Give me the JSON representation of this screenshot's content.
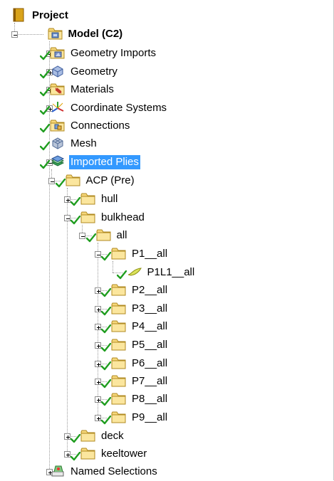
{
  "tree": {
    "nodes": [
      {
        "label": "Project",
        "icon": "project-book-icon",
        "bold": true,
        "checked": false,
        "toggle": "none"
      },
      {
        "label": "Model (C2)",
        "icon": "model-icon",
        "bold": true,
        "checked": false,
        "toggle": "expanded"
      },
      {
        "label": "Geometry Imports",
        "icon": "geometry-imports-folder-icon",
        "bold": false,
        "checked": true,
        "toggle": "collapsed"
      },
      {
        "label": "Geometry",
        "icon": "geometry-cube-icon",
        "bold": false,
        "checked": true,
        "toggle": "collapsed"
      },
      {
        "label": "Materials",
        "icon": "materials-folder-icon",
        "bold": false,
        "checked": true,
        "toggle": "collapsed"
      },
      {
        "label": "Coordinate Systems",
        "icon": "coordinate-axes-icon",
        "bold": false,
        "checked": true,
        "toggle": "collapsed"
      },
      {
        "label": "Connections",
        "icon": "connections-folder-icon",
        "bold": false,
        "checked": true,
        "toggle": "none"
      },
      {
        "label": "Mesh",
        "icon": "mesh-icon",
        "bold": false,
        "checked": true,
        "toggle": "none"
      },
      {
        "label": "Imported Plies",
        "icon": "imported-plies-icon",
        "bold": false,
        "checked": true,
        "toggle": "expanded",
        "selected": true
      },
      {
        "label": "ACP (Pre)",
        "icon": "folder-icon",
        "bold": false,
        "checked": true,
        "toggle": "expanded"
      },
      {
        "label": "hull",
        "icon": "folder-icon",
        "bold": false,
        "checked": true,
        "toggle": "collapsed"
      },
      {
        "label": "bulkhead",
        "icon": "folder-icon",
        "bold": false,
        "checked": true,
        "toggle": "expanded"
      },
      {
        "label": "all",
        "icon": "folder-icon",
        "bold": false,
        "checked": true,
        "toggle": "expanded"
      },
      {
        "label": "P1__all",
        "icon": "folder-icon",
        "bold": false,
        "checked": true,
        "toggle": "expanded"
      },
      {
        "label": "P1L1__all",
        "icon": "ply-layer-icon",
        "bold": false,
        "checked": true,
        "toggle": "none"
      },
      {
        "label": "P2__all",
        "icon": "folder-icon",
        "bold": false,
        "checked": true,
        "toggle": "collapsed"
      },
      {
        "label": "P3__all",
        "icon": "folder-icon",
        "bold": false,
        "checked": true,
        "toggle": "collapsed"
      },
      {
        "label": "P4__all",
        "icon": "folder-icon",
        "bold": false,
        "checked": true,
        "toggle": "collapsed"
      },
      {
        "label": "P5__all",
        "icon": "folder-icon",
        "bold": false,
        "checked": true,
        "toggle": "collapsed"
      },
      {
        "label": "P6__all",
        "icon": "folder-icon",
        "bold": false,
        "checked": true,
        "toggle": "collapsed"
      },
      {
        "label": "P7__all",
        "icon": "folder-icon",
        "bold": false,
        "checked": true,
        "toggle": "collapsed"
      },
      {
        "label": "P8__all",
        "icon": "folder-icon",
        "bold": false,
        "checked": true,
        "toggle": "collapsed"
      },
      {
        "label": "P9__all",
        "icon": "folder-icon",
        "bold": false,
        "checked": true,
        "toggle": "collapsed"
      },
      {
        "label": "deck",
        "icon": "folder-icon",
        "bold": false,
        "checked": true,
        "toggle": "collapsed"
      },
      {
        "label": "keeltower",
        "icon": "folder-icon",
        "bold": false,
        "checked": true,
        "toggle": "collapsed"
      },
      {
        "label": "Named Selections",
        "icon": "named-selections-icon",
        "bold": false,
        "checked": false,
        "toggle": "collapsed"
      }
    ]
  },
  "colors": {
    "selection": "#3399ff",
    "check": "#1f9d1f",
    "folder": "#f6d77a",
    "folder_edge": "#b08a20"
  }
}
